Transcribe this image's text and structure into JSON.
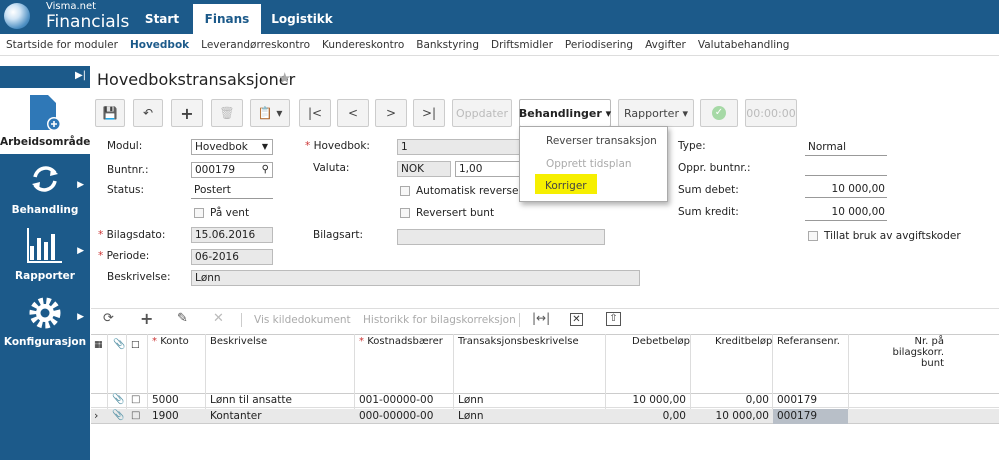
{
  "app": {
    "brand_small": "Visma.net",
    "brand_big": "Financials"
  },
  "top_tabs": [
    "Start",
    "Finans",
    "Logistikk"
  ],
  "subnav": [
    "Startside for moduler",
    "Hovedbok",
    "Leverandørreskontro",
    "Kundereskontro",
    "Bankstyring",
    "Driftsmidler",
    "Periodisering",
    "Avgifter",
    "Valutabehandling"
  ],
  "sidebar": [
    {
      "label": "Arbeidsområde"
    },
    {
      "label": "Behandling"
    },
    {
      "label": "Rapporter"
    },
    {
      "label": "Konfigurasjon"
    }
  ],
  "page": {
    "title": "Hovedbokstransaksjoner"
  },
  "toolbar": {
    "oppdater": "Oppdater",
    "behandlinger": "Behandlinger",
    "rapporter": "Rapporter",
    "timer": "00:00:00"
  },
  "dropdown": {
    "items": [
      "Reverser transaksjon",
      "Opprett tidsplan",
      "Korriger"
    ]
  },
  "form": {
    "modul_label": "Modul:",
    "modul_value": "Hovedbok",
    "buntnr_label": "Buntnr.:",
    "buntnr_value": "000179",
    "status_label": "Status:",
    "status_value": "Postert",
    "pa_vent": "På vent",
    "bilagsdato_label": "Bilagsdato:",
    "bilagsdato_value": "15.06.2016",
    "periode_label": "Periode:",
    "periode_value": "06-2016",
    "beskrivelse_label": "Beskrivelse:",
    "beskrivelse_value": "Lønn",
    "hovedbok_label": "Hovedbok:",
    "hovedbok_value": "1",
    "valuta_label": "Valuta:",
    "valuta_value": "NOK",
    "valuta_rate": "1,00",
    "auto_rev": "Automatisk reversering",
    "rev_bunt": "Reversert bunt",
    "bilagsart_label": "Bilagsart:",
    "type_label": "Type:",
    "type_value": "Normal",
    "oppr_label": "Oppr. buntnr.:",
    "sum_debet_label": "Sum debet:",
    "sum_debet_value": "10 000,00",
    "sum_kredit_label": "Sum kredit:",
    "sum_kredit_value": "10 000,00",
    "tillat": "Tillat bruk av avgiftskoder"
  },
  "grid": {
    "toolbar": {
      "vis": "Vis kildedokument",
      "historikk": "Historikk for bilagskorreksjon"
    },
    "headers": {
      "konto": "Konto",
      "beskrivelse": "Beskrivelse",
      "kostnad": "Kostnadsbærer",
      "transbesk": "Transaksjonsbeskrivelse",
      "debet": "Debetbeløp",
      "kredit": "Kreditbeløp",
      "ref": "Referansenr.",
      "nr1": "Nr. på bilagskorr.",
      "nr2": "bunt"
    },
    "rows": [
      {
        "konto": "5000",
        "beskrivelse": "Lønn til ansatte",
        "kostnad": "001-00000-00",
        "transbesk": "Lønn",
        "debet": "10 000,00",
        "kredit": "0,00",
        "ref": "000179"
      },
      {
        "konto": "1900",
        "beskrivelse": "Kontanter",
        "kostnad": "000-00000-00",
        "transbesk": "Lønn",
        "debet": "0,00",
        "kredit": "10 000,00",
        "ref": "000179"
      }
    ]
  }
}
